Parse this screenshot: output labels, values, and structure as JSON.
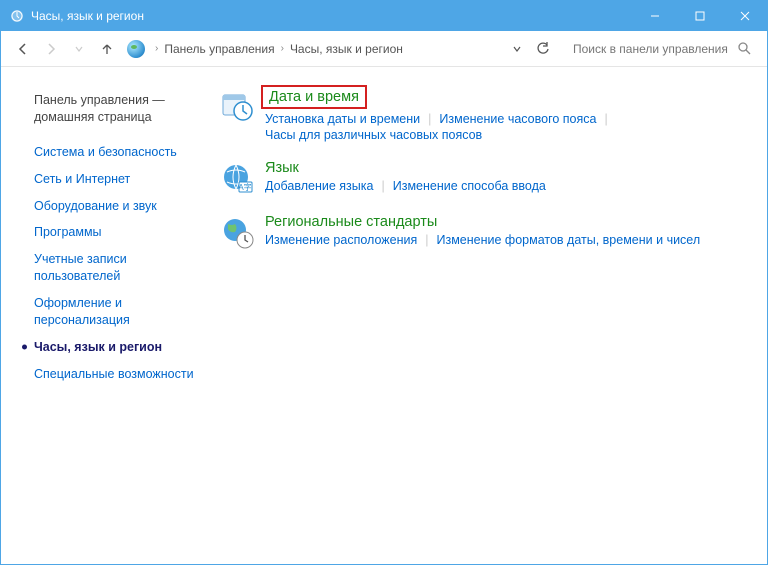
{
  "window": {
    "title": "Часы, язык и регион"
  },
  "breadcrumb": {
    "root": "Панель управления",
    "current": "Часы, язык и регион"
  },
  "search": {
    "placeholder": "Поиск в панели управления"
  },
  "sidebar": {
    "home": "Панель управления — домашняя страница",
    "items": [
      {
        "label": "Система и безопасность"
      },
      {
        "label": "Сеть и Интернет"
      },
      {
        "label": "Оборудование и звук"
      },
      {
        "label": "Программы"
      },
      {
        "label": "Учетные записи пользователей"
      },
      {
        "label": "Оформление и персонализация"
      },
      {
        "label": "Часы, язык и регион",
        "active": true
      },
      {
        "label": "Специальные возможности"
      }
    ]
  },
  "categories": [
    {
      "title": "Дата и время",
      "highlighted": true,
      "links_row1": [
        "Установка даты и времени",
        "Изменение часового пояса"
      ],
      "links_row2": [
        "Часы для различных часовых поясов"
      ]
    },
    {
      "title": "Язык",
      "links_row1": [
        "Добавление языка",
        "Изменение способа ввода"
      ],
      "links_row2": []
    },
    {
      "title": "Региональные стандарты",
      "links_row1": [
        "Изменение расположения",
        "Изменение форматов даты, времени и чисел"
      ],
      "links_row2": []
    }
  ]
}
